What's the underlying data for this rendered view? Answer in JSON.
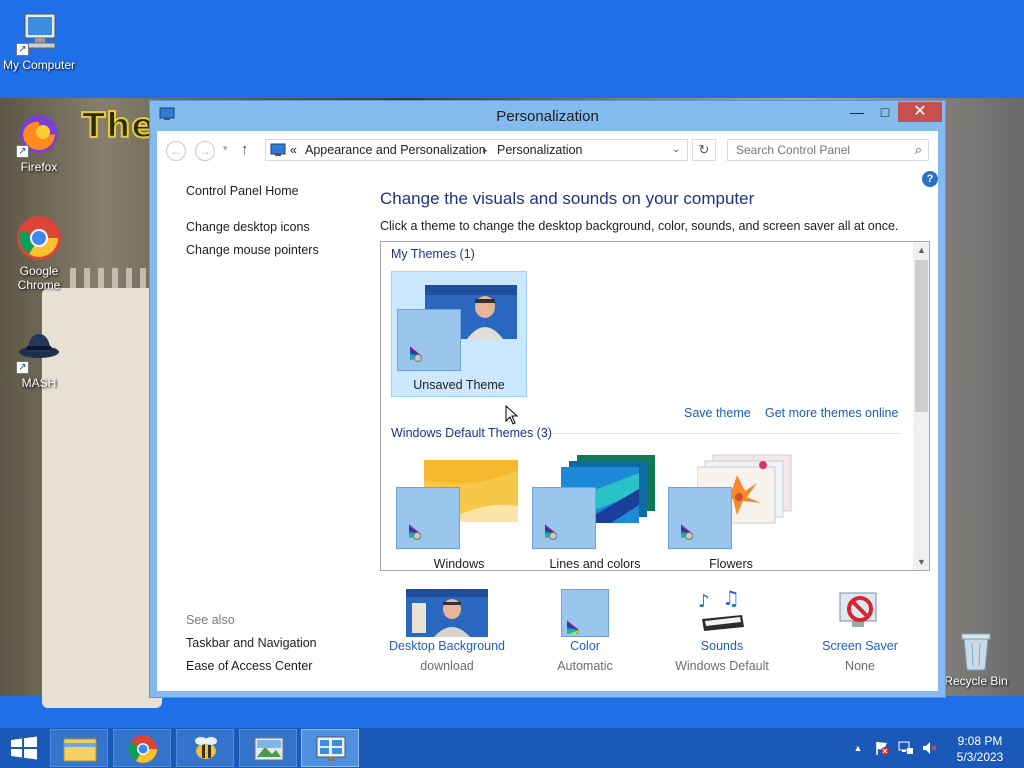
{
  "desktop": {
    "icons": [
      {
        "label": "My Computer"
      },
      {
        "label": "Firefox"
      },
      {
        "label": "Google Chrome"
      },
      {
        "label": "MASH"
      },
      {
        "label": "Recycle Bin"
      }
    ],
    "wallpaper_text": "Ther"
  },
  "window": {
    "title": "Personalization",
    "controls": {
      "minimize": "—",
      "maximize": "□",
      "close": "✕"
    },
    "address": {
      "prefix": "«",
      "crumbs": [
        "Appearance and Personalization",
        "Personalization"
      ],
      "separator": "▸"
    },
    "search": {
      "placeholder": "Search Control Panel"
    },
    "left_pane": {
      "home": "Control Panel Home",
      "links": [
        "Change desktop icons",
        "Change mouse pointers"
      ],
      "see_also_label": "See also",
      "see_also": [
        "Taskbar and Navigation",
        "Ease of Access Center"
      ]
    },
    "main": {
      "heading": "Change the visuals and sounds on your computer",
      "description": "Click a theme to change the desktop background, color, sounds, and screen saver all at once.",
      "my_themes": {
        "header": "My Themes (1)",
        "items": [
          {
            "label": "Unsaved Theme",
            "selected": true
          }
        ],
        "save_link": "Save theme",
        "more_link": "Get more themes online"
      },
      "default_themes": {
        "header": "Windows Default Themes (3)",
        "items": [
          {
            "label": "Windows"
          },
          {
            "label": "Lines and colors"
          },
          {
            "label": "Flowers"
          }
        ]
      },
      "bottom": [
        {
          "title": "Desktop Background",
          "subtitle": "download"
        },
        {
          "title": "Color",
          "subtitle": "Automatic"
        },
        {
          "title": "Sounds",
          "subtitle": "Windows Default"
        },
        {
          "title": "Screen Saver",
          "subtitle": "None"
        }
      ]
    }
  },
  "taskbar": {
    "apps": [
      "File Explorer",
      "Google Chrome",
      "Bee app",
      "Photos",
      "Control Panel"
    ],
    "clock": {
      "time": "9:08 PM",
      "date": "5/3/2023"
    }
  },
  "colors": {
    "accent": "#1a72e6",
    "link": "#1b5fb7",
    "heading": "#1e3287",
    "selected": "#cce8ff",
    "close": "#c75050"
  }
}
